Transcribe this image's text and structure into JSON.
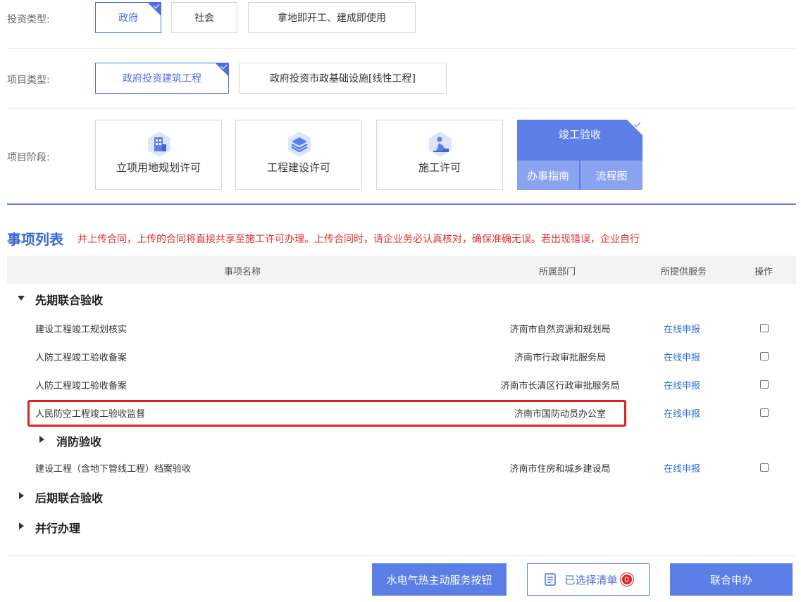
{
  "filters": {
    "investment_type": {
      "label": "投资类型:",
      "options": [
        "政府",
        "社会",
        "拿地即开工、建成即使用"
      ],
      "selected": "政府"
    },
    "project_type": {
      "label": "项目类型:",
      "options": [
        "政府投资建筑工程",
        "政府投资市政基础设施[线性工程]"
      ],
      "selected": "政府投资建筑工程"
    },
    "project_stage": {
      "label": "项目阶段:",
      "stages": [
        {
          "label": "立项用地规划许可",
          "icon": "building-chart-icon"
        },
        {
          "label": "工程建设许可",
          "icon": "layers-icon"
        },
        {
          "label": "施工许可",
          "icon": "construction-worker-icon"
        },
        {
          "label": "竣工验收",
          "icon": ""
        }
      ],
      "selected": "竣工验收",
      "active_links": [
        "办事指南",
        "流程图"
      ]
    }
  },
  "list": {
    "title": "事项列表",
    "notice": "并上传合同，上传的合同将直接共享至施工许可办理。上传合同时，请企业务必认真核对，确保准确无误。若出现错误，企业自行",
    "columns": [
      "事项名称",
      "所属部门",
      "所提供服务",
      "操作"
    ],
    "groups": [
      {
        "name": "先期联合验收",
        "expanded": true,
        "items": [
          {
            "name": "建设工程竣工规划核实",
            "dept": "济南市自然资源和规划局",
            "service": "在线申报"
          },
          {
            "name": "人防工程竣工验收备案",
            "dept": "济南市行政审批服务局",
            "service": "在线申报"
          },
          {
            "name": "人防工程竣工验收备案",
            "dept": "济南市长清区行政审批服务局",
            "service": "在线申报"
          },
          {
            "name": "人民防空工程竣工验收监督",
            "dept": "济南市国防动员办公室",
            "service": "在线申报"
          }
        ],
        "subgroup": {
          "name": "消防验收",
          "expanded": false
        },
        "after_items": [
          {
            "name": "建设工程（含地下管线工程）档案验收",
            "dept": "济南市住房和城乡建设局",
            "service": "在线申报"
          }
        ]
      },
      {
        "name": "后期联合验收",
        "expanded": false
      },
      {
        "name": "并行办理",
        "expanded": false
      }
    ]
  },
  "footer": {
    "btn_utilities": "水电气热主动服务按钮",
    "btn_selected": "已选择清单",
    "selected_count": "0",
    "btn_submit": "联合申办"
  },
  "colors": {
    "accent": "#5b7fe6",
    "link": "#2c6fd8",
    "warning": "#e03131"
  }
}
